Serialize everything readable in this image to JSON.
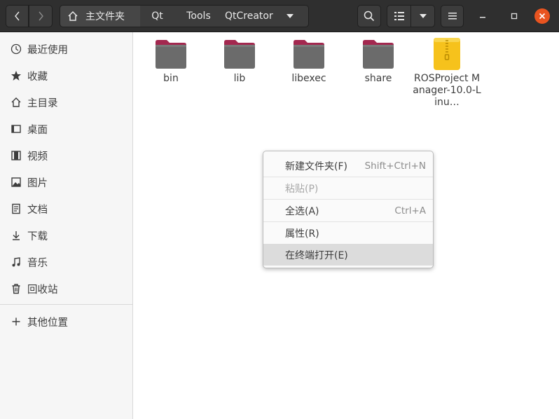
{
  "header": {
    "back_icon": "chevron-left-icon",
    "forward_icon": "chevron-right-icon",
    "breadcrumbs": [
      {
        "label": "主文件夹",
        "icon": "home-icon"
      },
      {
        "label": "Qt"
      },
      {
        "label": "Tools"
      },
      {
        "label": "QtCreator"
      }
    ],
    "search_icon": "search-icon",
    "view_icon": "list-view-icon",
    "menu_icon": "hamburger-icon"
  },
  "sidebar": {
    "items": [
      {
        "label": "最近使用",
        "icon": "clock-icon"
      },
      {
        "label": "收藏",
        "icon": "star-icon"
      },
      {
        "label": "主目录",
        "icon": "home-icon"
      },
      {
        "label": "桌面",
        "icon": "desktop-icon"
      },
      {
        "label": "视频",
        "icon": "film-icon"
      },
      {
        "label": "图片",
        "icon": "image-icon"
      },
      {
        "label": "文档",
        "icon": "document-icon"
      },
      {
        "label": "下载",
        "icon": "download-icon"
      },
      {
        "label": "音乐",
        "icon": "music-icon"
      },
      {
        "label": "回收站",
        "icon": "trash-icon"
      }
    ],
    "other_locations": {
      "label": "其他位置",
      "icon": "plus-icon"
    }
  },
  "files": [
    {
      "name": "bin",
      "type": "folder"
    },
    {
      "name": "lib",
      "type": "folder"
    },
    {
      "name": "libexec",
      "type": "folder"
    },
    {
      "name": "share",
      "type": "folder"
    },
    {
      "name": "ROSProject Manager-10.0-Linu…",
      "type": "archive"
    }
  ],
  "context_menu": {
    "items": [
      {
        "label": "新建文件夹(F)",
        "accel": "Shift+Ctrl+N",
        "disabled": false
      },
      {
        "label": "粘贴(P)",
        "accel": "",
        "disabled": true
      },
      {
        "label": "全选(A)",
        "accel": "Ctrl+A",
        "disabled": false
      },
      {
        "label": "属性(R)",
        "accel": "",
        "disabled": false
      },
      {
        "label": "在终端打开(E)",
        "accel": "",
        "disabled": false,
        "highlighted": true
      }
    ]
  },
  "colors": {
    "accent": "#e95420",
    "folder": "#6b6b6b",
    "folder_tab": "#a3284f",
    "archive": "#f6c21c"
  }
}
